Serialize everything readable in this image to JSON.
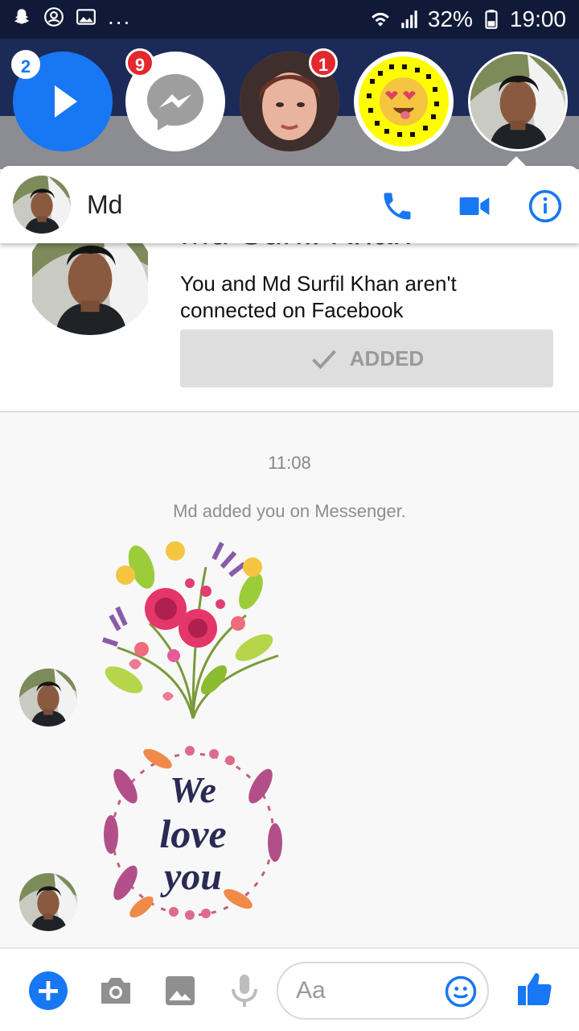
{
  "status_bar": {
    "battery": "32%",
    "time": "19:00",
    "more": "..."
  },
  "chat_heads": [
    {
      "badge": "2",
      "kind": "play"
    },
    {
      "badge": "9",
      "kind": "messenger"
    },
    {
      "badge": "1",
      "kind": "woman"
    },
    {
      "badge": "",
      "kind": "snapcode"
    },
    {
      "badge": "",
      "kind": "man"
    }
  ],
  "conversation": {
    "name": "Md",
    "profile_name_partial": "Md Surfil Khan",
    "connection_text": "You and Md Surfil Khan aren't connected on Facebook",
    "added_label": "ADDED",
    "time": "11:08",
    "notice": "Md added you on Messenger."
  },
  "composer": {
    "placeholder": "Aa"
  },
  "colors": {
    "accent": "#1877f2",
    "status_bar": "#101a38",
    "heads_bar": "#1c2a58",
    "badge_red": "#e4282d"
  },
  "icons": [
    "phone-icon",
    "video-icon",
    "info-icon",
    "add-icon",
    "camera-icon",
    "image-icon",
    "mic-icon",
    "emoji-icon",
    "thumbs-up-icon"
  ]
}
